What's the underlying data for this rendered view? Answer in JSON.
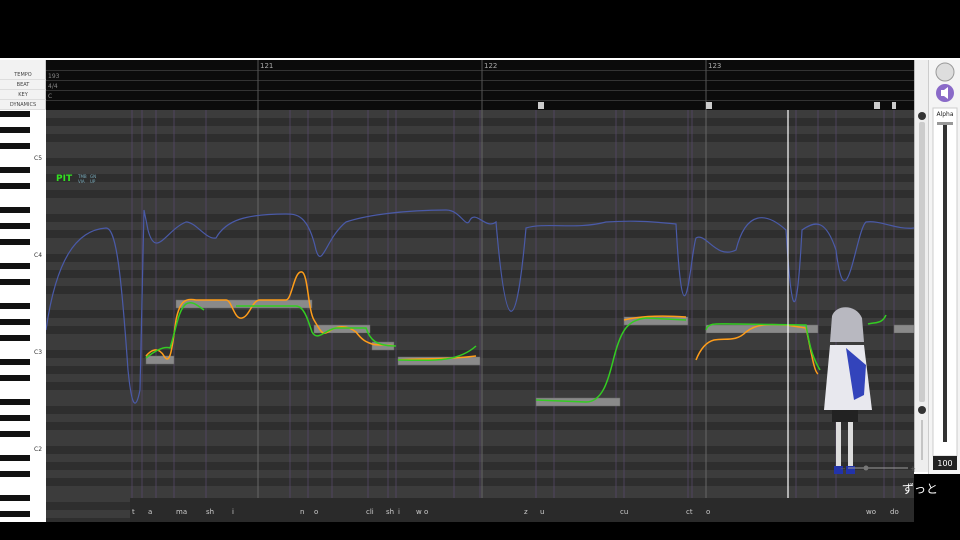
{
  "track_labels": [
    "TEMPO",
    "BEAT",
    "KEY",
    "DYNAMICS"
  ],
  "tempo_value": "193",
  "beat_value": "4/4",
  "key_value": "C",
  "measures": [
    "121",
    "122",
    "123"
  ],
  "piano_labels": [
    "C5",
    "C4",
    "C3",
    "C2"
  ],
  "pit_label": "PIT",
  "param_tags": [
    "TMB",
    "GN",
    "VIA",
    "UP"
  ],
  "lyrics": [
    "t",
    "a",
    "ma",
    "sh",
    "i",
    "n",
    "o",
    "cli",
    "sh",
    "i",
    "w",
    "o",
    "z",
    "u",
    "cu",
    "ct",
    "o",
    "wo",
    "do"
  ],
  "alpha_label": "Alpha",
  "alpha_value": "100",
  "subtitle": "ずっと",
  "colors": {
    "grid_bg": "#3a3a3a",
    "pitch_green": "#33cc22",
    "pitch_orange": "#ff9d1a",
    "pitch_blue": "#4a5aa8",
    "accent_purple": "#8a6ac8"
  },
  "icons": [
    "circle-button-icon",
    "speaker-icon",
    "scroll-up-icon",
    "scroll-down-icon",
    "zoom-minus-icon",
    "zoom-plus-icon"
  ]
}
